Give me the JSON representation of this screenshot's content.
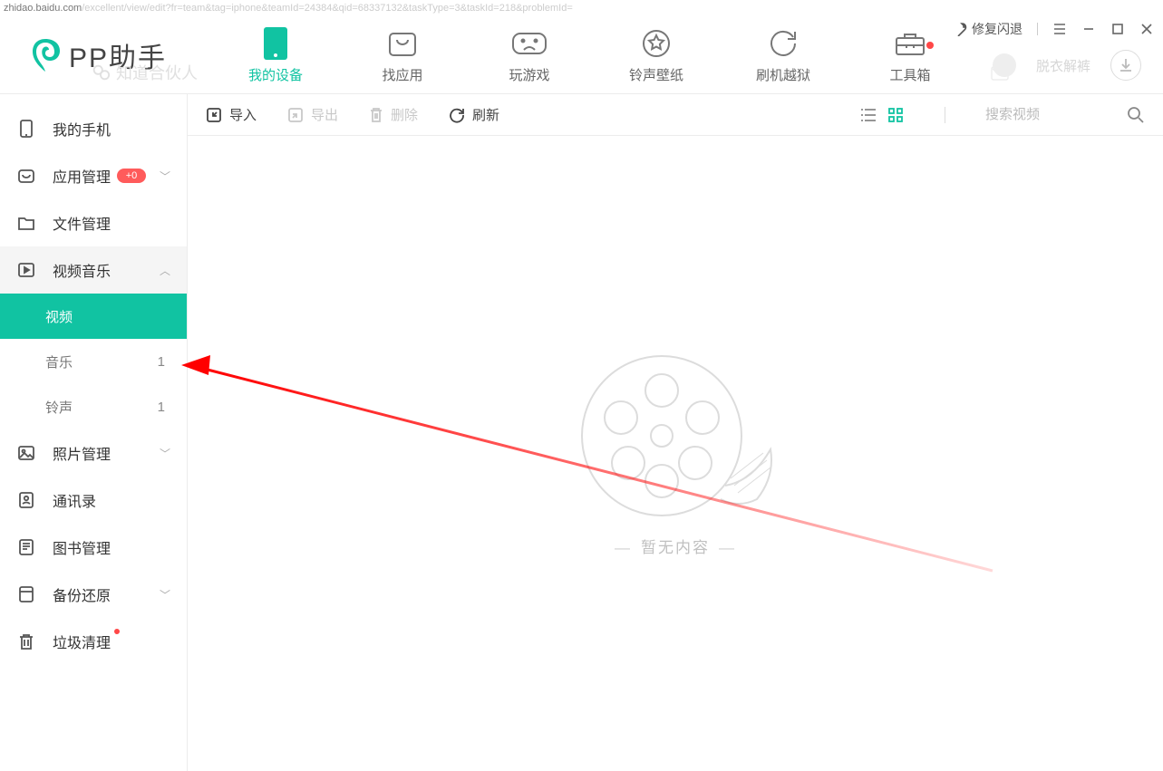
{
  "url": {
    "host": "zhidao.baidu.com",
    "path": "/excellent/view/edit?fr=team&tag=iphone&teamId=24384&qid=68337132&taskType=3&taskId=218&problemId="
  },
  "logo_text": "PP助手",
  "window": {
    "repair_label": "修复闪退"
  },
  "nav": [
    {
      "label": "我的设备"
    },
    {
      "label": "找应用"
    },
    {
      "label": "玩游戏"
    },
    {
      "label": "铃声壁纸"
    },
    {
      "label": "刷机越狱"
    },
    {
      "label": "工具箱"
    }
  ],
  "title_right": {
    "username": "脱衣解裤"
  },
  "faded_under_text": "知道合伙人",
  "sidebar": {
    "items": [
      {
        "label": "我的手机"
      },
      {
        "label": "应用管理",
        "pill": "+0"
      },
      {
        "label": "文件管理"
      },
      {
        "label": "视频音乐"
      },
      {
        "label": "照片管理"
      },
      {
        "label": "通讯录"
      },
      {
        "label": "图书管理"
      },
      {
        "label": "备份还原"
      },
      {
        "label": "垃圾清理"
      }
    ],
    "video_sub": [
      {
        "label": "视频",
        "count": ""
      },
      {
        "label": "音乐",
        "count": "1"
      },
      {
        "label": "铃声",
        "count": "1"
      }
    ]
  },
  "toolbar": {
    "import_label": "导入",
    "export_label": "导出",
    "delete_label": "删除",
    "refresh_label": "刷新",
    "search_placeholder": "搜索视频"
  },
  "content": {
    "empty_text": "暂无内容"
  }
}
